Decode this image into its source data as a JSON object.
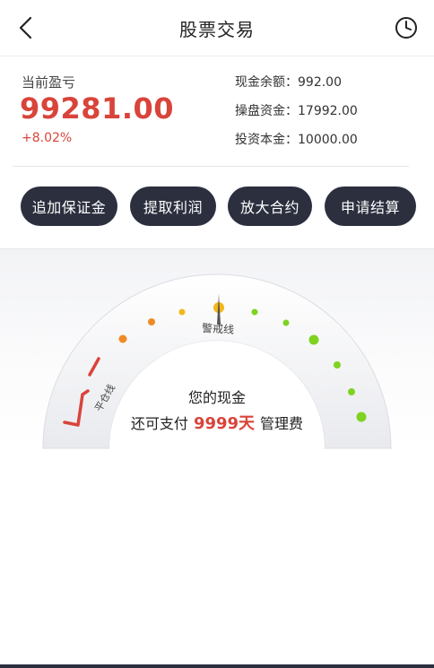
{
  "header": {
    "title": "股票交易",
    "back_icon": "chevron-left-icon",
    "history_icon": "clock-icon"
  },
  "summary": {
    "pl_label": "当前盈亏",
    "pl_value": "99281.00",
    "pl_percent": "+8.02%",
    "cash_balance": "现金余额：992.00",
    "trading_funds": "操盘资金：17992.00",
    "principal": "投资本金：10000.00"
  },
  "actions": {
    "add_margin": "追加保证金",
    "withdraw_profit": "提取利润",
    "expand_contract": "放大合约",
    "apply_settlement": "申请结算"
  },
  "gauge": {
    "warning_label": "警戒线",
    "liquidation_label": "平仓线",
    "line1": "您的现金",
    "line2_prefix": "还可支付",
    "days": "9999天",
    "line2_suffix": "管理费",
    "needle_position": 0.5
  },
  "colors": {
    "accent_red": "#d9443a",
    "button_bg": "#2b2f3e",
    "dot_orange": "#f08a24",
    "dot_yellow": "#f2b818",
    "dot_green": "#7ed321"
  }
}
